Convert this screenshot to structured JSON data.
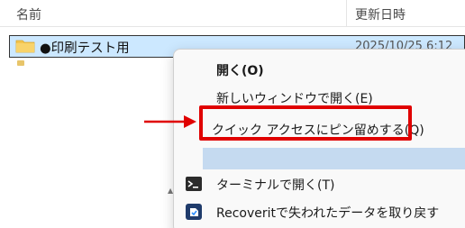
{
  "header": {
    "name_column": "名前",
    "date_column": "更新日時"
  },
  "file": {
    "name": "●印刷テスト用",
    "date": "2025/10/25 6:12",
    "icon": "folder-icon"
  },
  "context_menu": {
    "items": [
      {
        "label": "開く(O)",
        "bold": true
      },
      {
        "label": "新しいウィンドウで開く(E)"
      },
      {
        "label": "クイック アクセスにピン留めする(Q)",
        "highlighted": true
      },
      {
        "label": ""
      },
      {
        "label": "ターミナルで開く(T)",
        "icon": "terminal-icon"
      },
      {
        "label": "Recoveritで失われたデータを取り戻す",
        "icon": "recoverit-icon"
      }
    ]
  },
  "annotations": {
    "color": "#e00000",
    "highlight_target": "クイック アクセスにピン留めする(Q)"
  },
  "colors": {
    "selection": "#cce8ff",
    "menu_hover": "#c5daf0",
    "folder": "#f3c44e"
  }
}
